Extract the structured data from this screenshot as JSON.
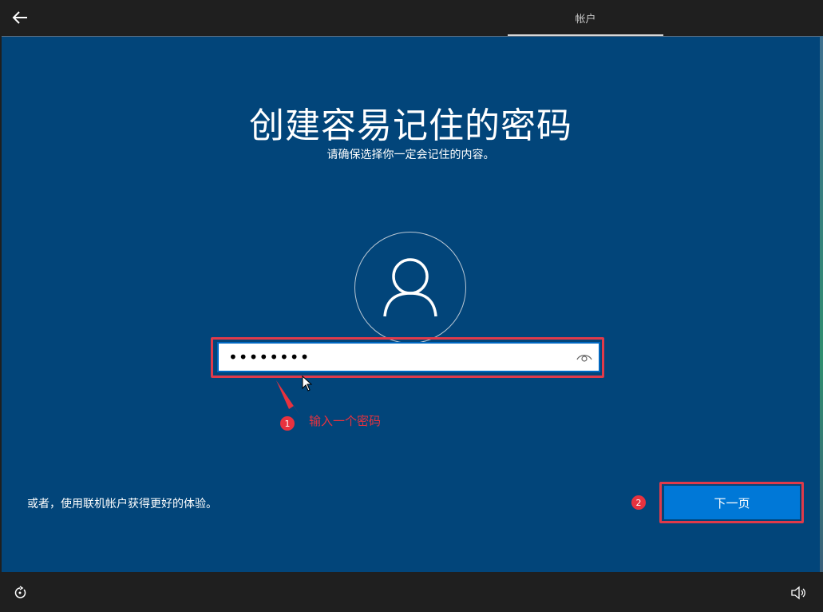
{
  "header": {
    "tab_label": "帐户"
  },
  "main": {
    "title": "创建容易记住的密码",
    "subtitle": "请确保选择你一定会记住的内容。",
    "password": {
      "value": "••••••••"
    },
    "annotation_1": {
      "number": "1",
      "text": "输入一个密码"
    },
    "annotation_2": {
      "number": "2"
    },
    "alt_link": "或者，使用联机帐户获得更好的体验。",
    "next_button": "下一页"
  },
  "icons": {
    "back": "back-arrow-icon",
    "user": "user-icon",
    "reveal": "eye-icon",
    "accessibility": "ease-of-access-icon",
    "volume": "volume-icon"
  },
  "colors": {
    "background": "#02457a",
    "primary_button": "#0078d7",
    "annotation_red": "#e8323f",
    "bar": "#1f1f1f"
  }
}
